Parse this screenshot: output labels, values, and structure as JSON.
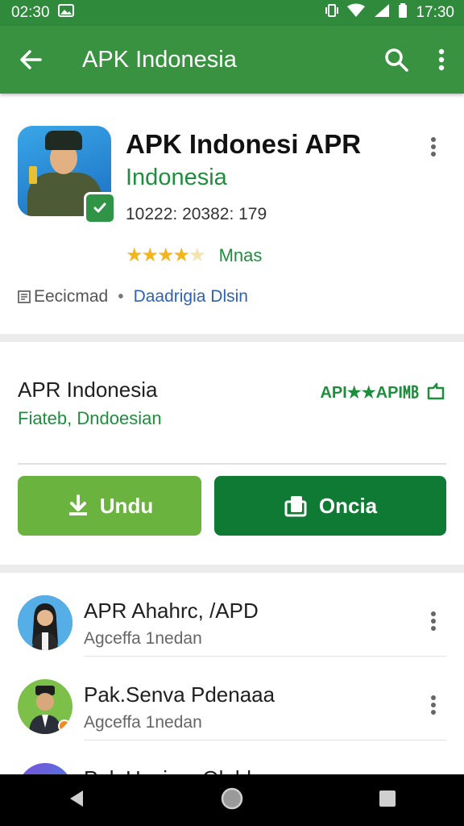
{
  "status_bar": {
    "time_left": "02:30",
    "time_right": "17:30"
  },
  "app_bar": {
    "title": "APK Indonesia",
    "back_icon": "arrow-left-icon",
    "search_icon": "search-icon",
    "menu_icon": "more-vert-icon"
  },
  "app_card": {
    "title": "APK Indonesi APR",
    "developer": "Indonesia",
    "meta": "10222: 20382: 179",
    "stars_filled": 4,
    "stars_total": 5,
    "rating_label": "Mnas",
    "tag1": "Eecicmad",
    "tag_separator": "•",
    "tag2": "Daadrigia Dlsin"
  },
  "info_card": {
    "title": "APR Indonesia",
    "subtitle": "Fiateb, Dndoesian",
    "right_label": "API★★API㎆",
    "download_button": "Undu",
    "open_button": "Oncia"
  },
  "list": {
    "rows": [
      {
        "name": "APR Ahahrc, /APD",
        "subtitle": "Agceffa 1nedan"
      },
      {
        "name": "Pak.Senva Pdenaaa",
        "subtitle": "Agceffa 1nedan"
      },
      {
        "name": "Pak Hsairsa Olabkur",
        "subtitle": ""
      }
    ]
  },
  "colors": {
    "primary": "#38923f",
    "status": "#2f8a3c",
    "accent_green": "#1e8e3e",
    "button_light": "#6bb33f",
    "button_dark": "#0f7a34",
    "star": "#f2b51e",
    "link_blue": "#2d63b5"
  }
}
